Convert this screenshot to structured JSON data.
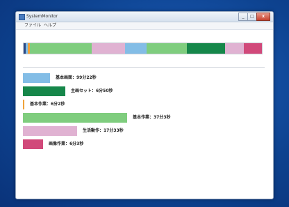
{
  "window": {
    "title": "SystemMonitor",
    "buttons": {
      "minimize": "_",
      "maximize": "□",
      "close": "x"
    }
  },
  "menu": {
    "file": "ファイル",
    "help": "ヘルプ"
  },
  "colors": {
    "light_blue": "#83bde6",
    "dark_green": "#16874a",
    "orange": "#f0a23a",
    "light_green": "#7fcd7e",
    "light_pink": "#e0b2d2",
    "magenta": "#d1497a",
    "dark_blue": "#2b4a86"
  },
  "timeline": {
    "segments": [
      {
        "name": "dark-blue",
        "color": "#2b4a86",
        "share": 0.01
      },
      {
        "name": "light-blue",
        "color": "#83bde6",
        "share": 0.01
      },
      {
        "name": "orange",
        "color": "#f0a23a",
        "share": 0.01
      },
      {
        "name": "light-green",
        "color": "#7fcd7e",
        "share": 0.26
      },
      {
        "name": "light-pink",
        "color": "#e0b2d2",
        "share": 0.14
      },
      {
        "name": "light-blue",
        "color": "#83bde6",
        "share": 0.09
      },
      {
        "name": "light-green",
        "color": "#7fcd7e",
        "share": 0.17
      },
      {
        "name": "dark-green",
        "color": "#16874a",
        "share": 0.16
      },
      {
        "name": "light-pink",
        "color": "#e0b2d2",
        "share": 0.08
      },
      {
        "name": "magenta",
        "color": "#d1497a",
        "share": 0.09
      }
    ]
  },
  "rows": [
    {
      "label": "基本画面：99分22秒",
      "color": "#83bde6",
      "share": 0.26
    },
    {
      "label": "主画セット：6分50秒",
      "color": "#16874a",
      "share": 0.41
    },
    {
      "label": "基本作業：6分2秒",
      "color": "#f0a23a",
      "share": 0.01
    },
    {
      "label": "基本作業：37分3秒",
      "color": "#7fcd7e",
      "share": 1.0
    },
    {
      "label": "生活動作：17分33秒",
      "color": "#e0b2d2",
      "share": 0.52
    },
    {
      "label": "画像作業：6分3秒",
      "color": "#d1497a",
      "share": 0.19
    }
  ]
}
